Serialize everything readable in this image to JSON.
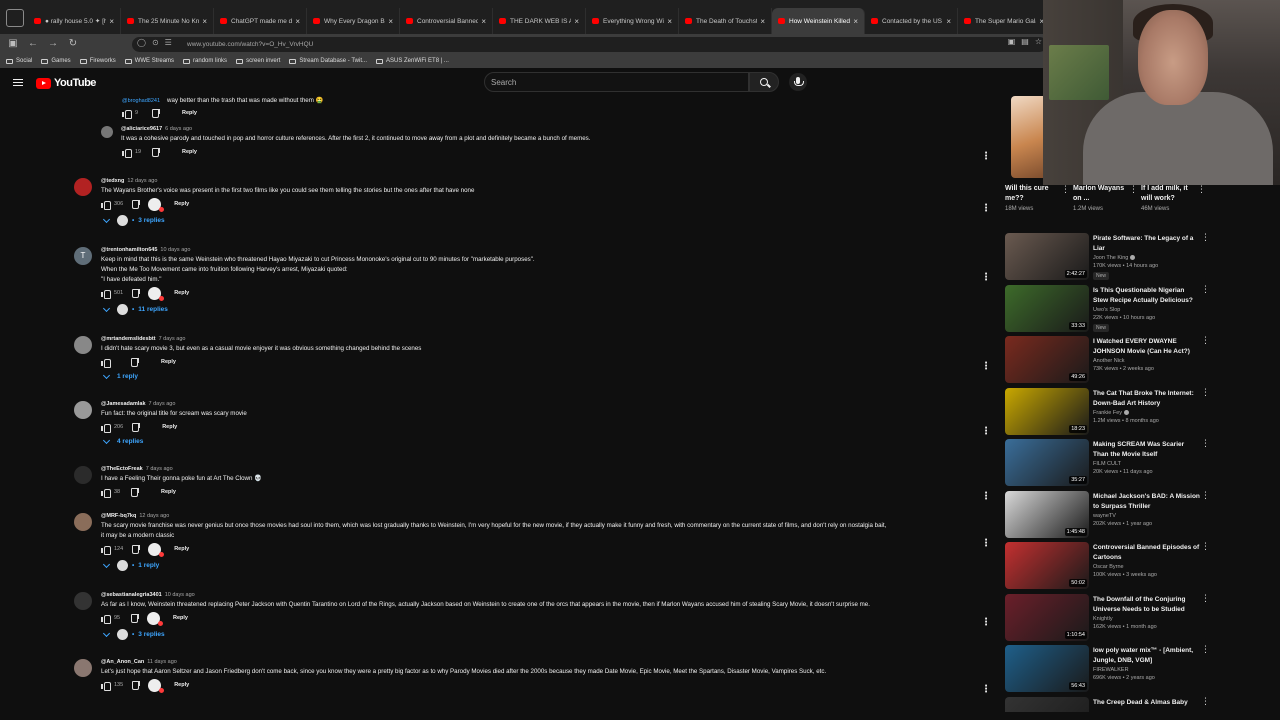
{
  "browser": {
    "tabs": [
      {
        "label": "● rally house 5.0 ✦ [ho",
        "active": false
      },
      {
        "label": "The 25 Minute No Knead",
        "active": false
      },
      {
        "label": "ChatGPT made me delu",
        "active": false
      },
      {
        "label": "Why Every Dragon Ball Z",
        "active": false
      },
      {
        "label": "Controversial Banned Ep",
        "active": false
      },
      {
        "label": "THE DARK WEB IS A PSY",
        "active": false
      },
      {
        "label": "Everything Wrong With",
        "active": false
      },
      {
        "label": "The Death of Touchstone",
        "active": false
      },
      {
        "label": "How Weinstein Killed Sc",
        "active": true
      },
      {
        "label": "Contacted by the US Se",
        "active": false
      },
      {
        "label": "The Super Mario Galaxy",
        "active": false
      }
    ],
    "url": "www.youtube.com/watch?v=O_Hv_VrvHQU",
    "bookmarks": [
      "Social",
      "Games",
      "Fireworks",
      "WWE Streams",
      "random links",
      "screen invert",
      "Stream Database - Twit...",
      "ASUS ZenWiFi ET8 | ..."
    ]
  },
  "header": {
    "logo_text": "YouTube",
    "search_placeholder": "Search"
  },
  "comments": [
    {
      "author": "@broghad8241",
      "age": "",
      "text": "way better than the trash that was made without them 🤮",
      "likes": "9",
      "heart": false,
      "replies": ""
    },
    {
      "author": "@aliciarice9617",
      "age": "6 days ago",
      "text": "It was a cohesive parody and touched in pop and horror culture references. After the first 2, it continued to move away from a plot and definitely became a bunch of memes.",
      "likes": "19",
      "heart": false,
      "replies": ""
    },
    {
      "author": "@tedxng",
      "age": "12 days ago",
      "text": "The Wayans Brother's voice was present in the first two films like you could see them telling the stories but the ones after that have none",
      "likes": "306",
      "heart": true,
      "replies": "3 replies"
    },
    {
      "author": "@trentonhamilton645",
      "age": "10 days ago",
      "text": "Keep in mind that this is the same Weinstein who threatened Hayao Miyazaki to cut Princess Mononoke's original cut to 90 minutes for \"marketable purposes\".\nWhen the Me Too Movement came into fruition following Harvey's arrest, Miyazaki quoted:\n\"I have defeated him.\"",
      "likes": "501",
      "heart": true,
      "replies": "11 replies"
    },
    {
      "author": "@mrtandemslidesbtt",
      "age": "7 days ago",
      "text": "I didn't hate scary movie 3, but even as a casual movie enjoyer it was obvious something changed behind the scenes",
      "likes": "",
      "heart": false,
      "replies": "1 reply"
    },
    {
      "author": "@Jamesadamlak",
      "age": "7 days ago",
      "text": "Fun fact: the original title for scream was scary movie",
      "likes": "206",
      "heart": false,
      "replies": "4 replies"
    },
    {
      "author": "@TheEctoFreak",
      "age": "7 days ago",
      "text": "I have a Feeling Their gonna poke fun at Art The Clown 💀",
      "likes": "38",
      "heart": false,
      "replies": ""
    },
    {
      "author": "@MRF-bq7kq",
      "age": "12 days ago",
      "text": "The scary movie franchise was never genius but once those movies had soul into them, which was lost gradually thanks to Weinstein, I'm very hopeful for the new movie, if they actually make it funny and fresh, with commentary on the current state of films, and don't rely on nostalgia bait,\nit may be a modern classic",
      "likes": "124",
      "heart": true,
      "replies": "1 reply"
    },
    {
      "author": "@sebastianalegria3401",
      "age": "10 days ago",
      "text": "As far as I know, Weinstein threatened replacing Peter Jackson with Quentin Tarantino on Lord of the Rings, actually Jackson based on Weinstein to create one of the orcs that appears in the movie, then if Marlon Wayans accused him of stealing Scary Movie, it doesn't surprise me.",
      "likes": "95",
      "heart": true,
      "replies": "3 replies"
    },
    {
      "author": "@An_Anon_Can",
      "age": "11 days ago",
      "text": "Let's just hope that Aaron Seltzer and Jason Friedberg don't come back, since you know they were a pretty big factor as to why Parody Movies died after the 2000s because they made Date Movie, Epic Movie, Meet the Spartans, Disaster Movie, Vampires Suck, etc.",
      "likes": "135",
      "heart": true,
      "replies": ""
    }
  ],
  "reply_label": "Reply",
  "shorts": [
    {
      "title": "Will this cure me??",
      "views": "18M views"
    },
    {
      "title": "Marlon Wayans on ...",
      "views": "1.2M views"
    },
    {
      "title": "If I add milk, it will work?",
      "views": "46M views"
    }
  ],
  "videos": [
    {
      "title": "Pirate Software: The Legacy of a Liar",
      "channel": "Joon The King",
      "verified": true,
      "meta": "170K views • 14 hours ago",
      "duration": "2:42:27",
      "new": "New",
      "color": "#6a5a50"
    },
    {
      "title": "Is This Questionable Nigerian Stew Recipe Actually Delicious?",
      "channel": "Uwo's Slop",
      "verified": false,
      "meta": "22K views • 10 hours ago",
      "duration": "33:33",
      "new": "New",
      "color": "#3d6b2a"
    },
    {
      "title": "I Watched EVERY DWAYNE JOHNSON Movie (Can He Act?)",
      "channel": "Another Nick",
      "verified": false,
      "meta": "73K views • 2 weeks ago",
      "duration": "49:26",
      "new": "",
      "color": "#7a2a1e"
    },
    {
      "title": "The Cat That Broke The Internet: Down-Bad Art History",
      "channel": "Frankie Fey",
      "verified": true,
      "meta": "1.2M views • 8 months ago",
      "duration": "18:23",
      "new": "",
      "color": "#c9a800"
    },
    {
      "title": "Making SCREAM Was Scarier Than the Movie Itself",
      "channel": "FILM CULT",
      "verified": false,
      "meta": "20K views • 11 days ago",
      "duration": "35:27",
      "new": "",
      "color": "#3a6e9a"
    },
    {
      "title": "Michael Jackson's BAD: A Mission to Surpass Thriller",
      "channel": "wayneTV",
      "verified": false,
      "meta": "202K views • 1 year ago",
      "duration": "1:45:48",
      "new": "",
      "color": "#d9d9d9"
    },
    {
      "title": "Controversial Banned Episodes of Cartoons",
      "channel": "Oscar Byrne",
      "verified": false,
      "meta": "100K views • 3 weeks ago",
      "duration": "50:02",
      "new": "",
      "color": "#c43030"
    },
    {
      "title": "The Downfall of the Conjuring Universe Needs to be Studied",
      "channel": "Knightly",
      "verified": false,
      "meta": "162K views • 1 month ago",
      "duration": "1:10:54",
      "new": "",
      "color": "#6b1f2a"
    },
    {
      "title": "low poly water mix™ - [Ambient, Jungle, DNB, VGM]",
      "channel": "FIREWALKER",
      "verified": false,
      "meta": "696K views • 2 years ago",
      "duration": "56:43",
      "new": "",
      "color": "#1e5f8a"
    },
    {
      "title": "The Creep Dead & Almas Baby",
      "channel": "",
      "verified": false,
      "meta": "",
      "duration": "",
      "new": "",
      "color": "#333333"
    }
  ]
}
